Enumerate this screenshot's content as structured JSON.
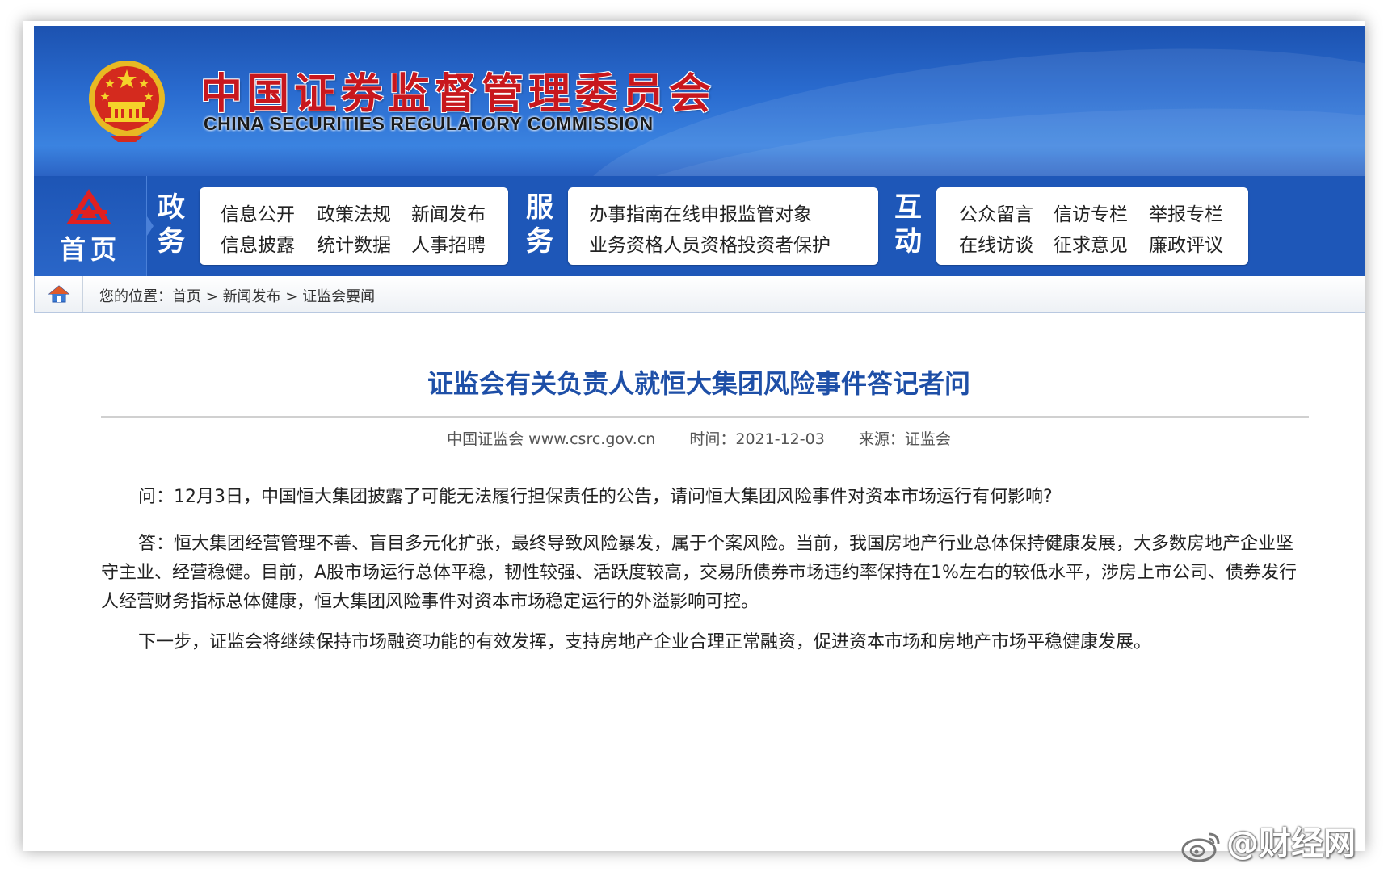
{
  "header": {
    "title_cn": "中国证券监督管理委员会",
    "title_en": "CHINA SECURITIES REGULATORY COMMISSION",
    "colors": {
      "banner": "#2a6cd0",
      "title_red": "#c8171d",
      "nav": "#1e57b8"
    }
  },
  "nav": {
    "home_label": "首页",
    "sections": [
      {
        "label": "政务",
        "links": [
          "信息公开",
          "政策法规",
          "新闻发布",
          "信息披露",
          "统计数据",
          "人事招聘"
        ]
      },
      {
        "label": "服务",
        "links": [
          "办事指南在线申报监管对象",
          "业务资格人员资格投资者保护"
        ]
      },
      {
        "label": "互动",
        "links": [
          "公众留言",
          "信访专栏",
          "举报专栏",
          "在线访谈",
          "征求意见",
          "廉政评议"
        ]
      }
    ]
  },
  "breadcrumb": {
    "prefix": "您的位置：",
    "items": [
      "首页",
      "新闻发布",
      "证监会要闻"
    ],
    "separator": ">"
  },
  "article": {
    "title": "证监会有关负责人就恒大集团风险事件答记者问",
    "meta": {
      "site": "中国证监会 www.csrc.gov.cn",
      "time": "时间：2021-12-03",
      "source": "来源：证监会"
    },
    "paragraphs": [
      "问：12月3日，中国恒大集团披露了可能无法履行担保责任的公告，请问恒大集团风险事件对资本市场运行有何影响?",
      "答：恒大集团经营管理不善、盲目多元化扩张，最终导致风险暴发，属于个案风险。当前，我国房地产行业总体保持健康发展，大多数房地产企业坚守主业、经营稳健。目前，A股市场运行总体平稳，韧性较强、活跃度较高，交易所债券市场违约率保持在1%左右的较低水平，涉房上市公司、债券发行人经营财务指标总体健康，恒大集团风险事件对资本市场稳定运行的外溢影响可控。",
      "下一步，证监会将继续保持市场融资功能的有效发挥，支持房地产企业合理正常融资，促进资本市场和房地产市场平稳健康发展。"
    ]
  },
  "watermark": {
    "text": "@财经网",
    "icon": "weibo-icon"
  }
}
